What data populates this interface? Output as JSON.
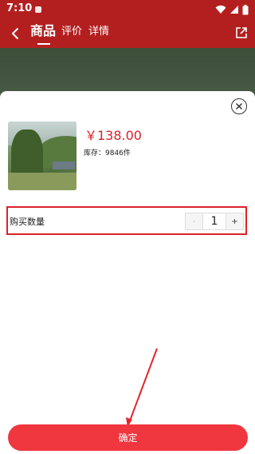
{
  "status_bar": {
    "time": "7:10"
  },
  "header": {
    "tabs": [
      {
        "label": "商品",
        "active": true
      },
      {
        "label": "评价",
        "active": false
      },
      {
        "label": "详情",
        "active": false
      }
    ],
    "back_icon": "chevron-left-icon",
    "share_icon": "share-icon"
  },
  "sheet": {
    "close_icon": "close-icon",
    "price": "￥138.00",
    "stock": "库存：9846件",
    "quantity_label": "购买数量",
    "quantity": {
      "minus": "-",
      "value": "1",
      "plus": "+"
    },
    "confirm_label": "确定"
  },
  "colors": {
    "header_bg": "#b31f1f",
    "price": "#d9232a",
    "highlight_border": "#d9232a",
    "confirm_bg": "#f0363e"
  }
}
